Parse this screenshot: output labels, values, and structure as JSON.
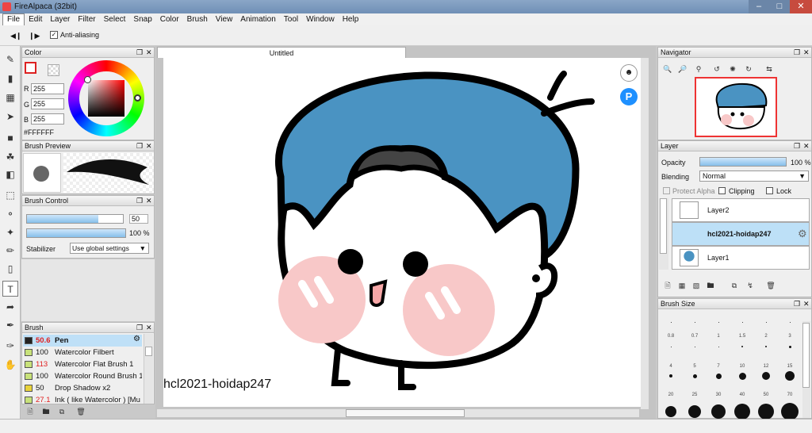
{
  "window": {
    "title": "FireAlpaca (32bit)"
  },
  "menu": [
    "File",
    "Edit",
    "Layer",
    "Filter",
    "Select",
    "Snap",
    "Color",
    "Brush",
    "View",
    "Animation",
    "Tool",
    "Window",
    "Help"
  ],
  "options": {
    "antialias_label": "Anti-aliasing",
    "antialias_checked": "✓"
  },
  "color_panel": {
    "title": "Color",
    "r_label": "R",
    "r_value": "255",
    "g_label": "G",
    "g_value": "255",
    "b_label": "B",
    "b_value": "255",
    "hex": "#FFFFFF"
  },
  "brush_preview": {
    "title": "Brush Preview"
  },
  "brush_control": {
    "title": "Brush Control",
    "size_value": "50",
    "size_fraction": 0.74,
    "opacity_value": "100",
    "opacity_unit": "%",
    "opacity_fraction": 1.0,
    "stabilizer_label": "Stabilizer",
    "stabilizer_value": "Use global settings"
  },
  "brush_list": {
    "title": "Brush",
    "items": [
      {
        "size": "50.6",
        "name": "Pen",
        "color": "#222222",
        "size_color": "#e02020"
      },
      {
        "size": "100",
        "name": "Watercolor Filbert",
        "color": "#c8e27a",
        "size_color": "#111111"
      },
      {
        "size": "113",
        "name": "Watercolor Flat Brush 1",
        "color": "#c8e27a",
        "size_color": "#e02020"
      },
      {
        "size": "100",
        "name": "Watercolor Round Brush 1",
        "color": "#c8e27a",
        "size_color": "#111111"
      },
      {
        "size": "50",
        "name": "Drop Shadow x2",
        "color": "#e8d23a",
        "size_color": "#111111"
      },
      {
        "size": "27.1",
        "name": "Ink ( like Watercolor ) [Mu",
        "color": "#c8e27a",
        "size_color": "#e02020"
      }
    ]
  },
  "document": {
    "tab": "Untitled",
    "watermark": "hcl2021-hoidap247"
  },
  "navigator": {
    "title": "Navigator"
  },
  "layer_panel": {
    "title": "Layer",
    "opacity_label": "Opacity",
    "opacity_value": "100",
    "opacity_unit": "%",
    "blending_label": "Blending",
    "blending_value": "Normal",
    "protect_alpha": "Protect Alpha",
    "clipping": "Clipping",
    "lock": "Lock",
    "layers": [
      {
        "name": "Layer2"
      },
      {
        "name": "hcl2021-hoidap247"
      },
      {
        "name": "Layer1"
      }
    ]
  },
  "brush_size": {
    "title": "Brush Size",
    "rows": [
      [
        "0.8",
        "0.7",
        "1",
        "1.5",
        "2",
        "3"
      ],
      [
        "4",
        "5",
        "7",
        "10",
        "12",
        "15"
      ],
      [
        "20",
        "25",
        "30",
        "40",
        "50",
        "70"
      ]
    ]
  },
  "colors": {
    "accent": "#86bfea",
    "hair": "#4a93c2",
    "cheek": "#f8c8c8",
    "selection": "#bde0f7"
  }
}
